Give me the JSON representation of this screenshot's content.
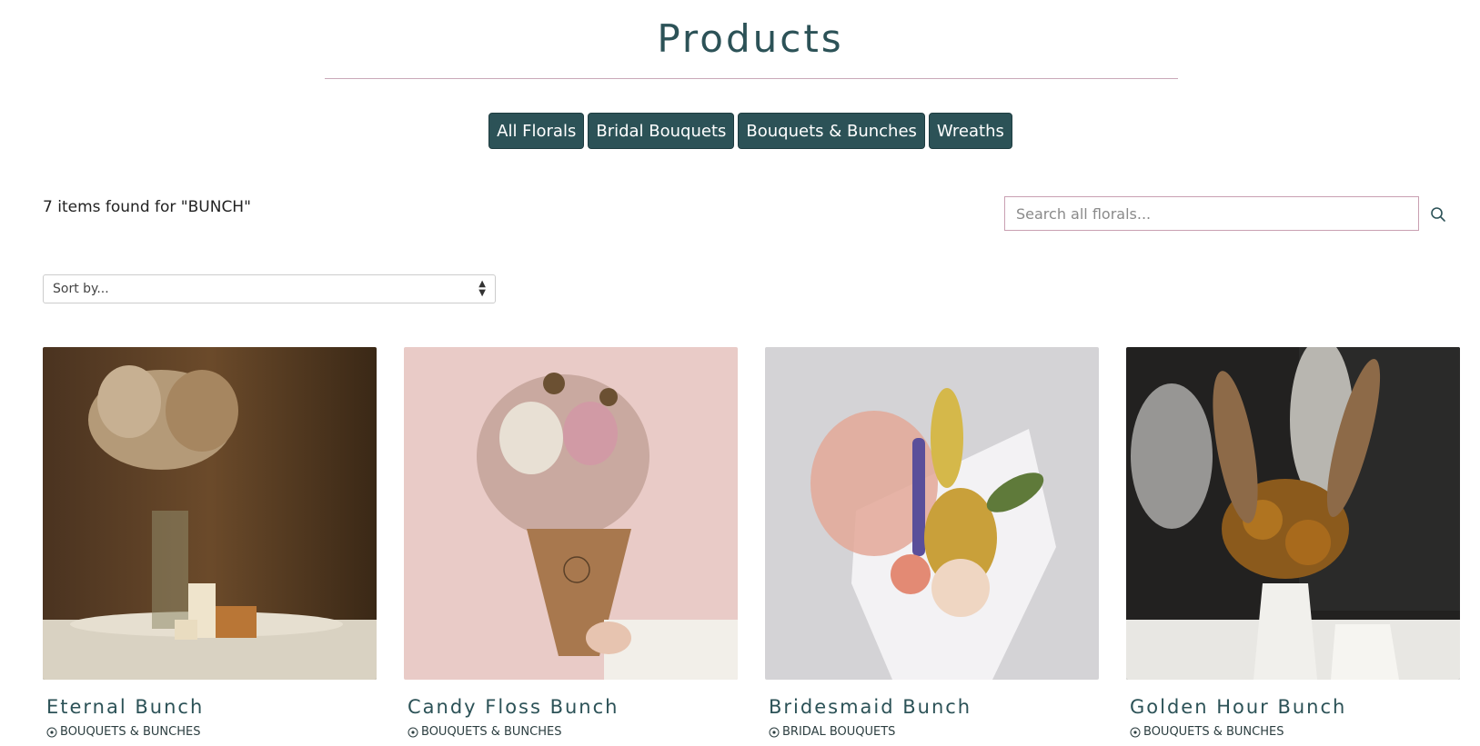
{
  "page": {
    "title": "Products"
  },
  "categories": [
    {
      "label": "All Florals"
    },
    {
      "label": "Bridal Bouquets"
    },
    {
      "label": "Bouquets & Bunches"
    },
    {
      "label": "Wreaths"
    }
  ],
  "results": {
    "text": "7 items found for \"BUNCH\""
  },
  "search": {
    "placeholder": "Search all florals..."
  },
  "sort": {
    "label": "Sort by..."
  },
  "products": [
    {
      "name": "Eternal Bunch",
      "category": "BOUQUETS & BUNCHES"
    },
    {
      "name": "Candy Floss Bunch",
      "category": "BOUQUETS & BUNCHES"
    },
    {
      "name": "Bridesmaid Bunch",
      "category": "BRIDAL BOUQUETS"
    },
    {
      "name": "Golden Hour Bunch",
      "category": "BOUQUETS & BUNCHES"
    }
  ],
  "colors": {
    "accent": "#2c5257",
    "rule": "#c9a9b8",
    "search_border": "#c9a0b2"
  }
}
